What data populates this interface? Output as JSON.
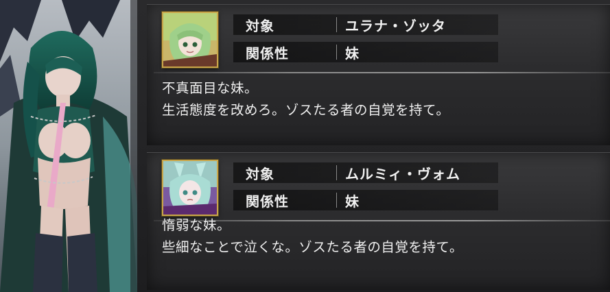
{
  "relations": [
    {
      "avatar_icon": "character-portrait-yurana-icon",
      "target_label": "対象",
      "target_value": "ユラナ・ゾッタ",
      "relation_label": "関係性",
      "relation_value": "妹",
      "description_line1": "不真面目な妹。",
      "description_line2": "生活態度を改めろ。ゾスたる者の自覚を持て。"
    },
    {
      "avatar_icon": "character-portrait-mulmi-icon",
      "target_label": "対象",
      "target_value": "ムルミィ・ヴォム",
      "relation_label": "関係性",
      "relation_value": "妹",
      "description_line1": "惰弱な妹。",
      "description_line2": "些細なことで泣くな。ゾスたる者の自覚を持て。"
    }
  ],
  "colors": {
    "accent_gold": "#c9a64a",
    "text": "#f0f0f0",
    "panel_bg": "#2c2c2e"
  }
}
